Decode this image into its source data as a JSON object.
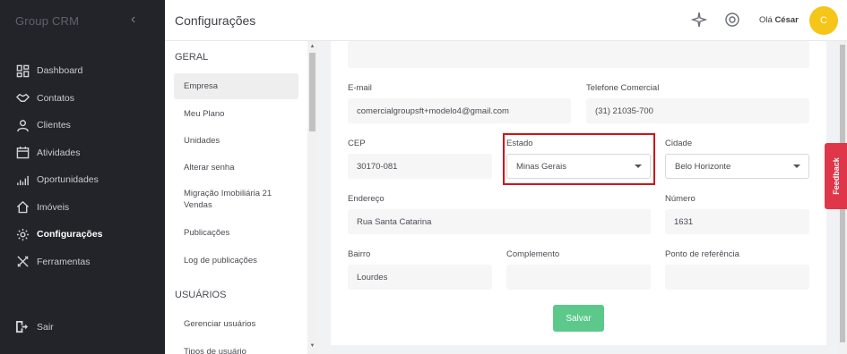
{
  "sidebar": {
    "brand": "Group CRM",
    "items": [
      {
        "label": "Dashboard",
        "icon": "dashboard-icon"
      },
      {
        "label": "Contatos",
        "icon": "handshake-icon"
      },
      {
        "label": "Clientes",
        "icon": "user-icon"
      },
      {
        "label": "Atividades",
        "icon": "calendar-icon"
      },
      {
        "label": "Oportunidades",
        "icon": "chart-icon"
      },
      {
        "label": "Imóveis",
        "icon": "home-icon"
      },
      {
        "label": "Configurações",
        "icon": "gear-icon",
        "active": true
      },
      {
        "label": "Ferramentas",
        "icon": "tools-icon"
      }
    ],
    "logout": "Sair"
  },
  "header": {
    "title": "Configurações",
    "greeting": "Olá",
    "user_name": "César",
    "avatar_letter": "C"
  },
  "submenu": {
    "section1": "GERAL",
    "items": [
      "Empresa",
      "Meu Plano",
      "Unidades",
      "Alterar senha",
      "Migração Imobiliária 21 Vendas",
      "Publicações",
      "Log de publicações"
    ],
    "section2": "USUÁRIOS",
    "items2": [
      "Gerenciar usuários",
      "Tipos de usuário"
    ]
  },
  "form": {
    "email_label": "E-mail",
    "email_value": "comercialgroupsft+modelo4@gmail.com",
    "phone_label": "Telefone Comercial",
    "phone_value": "(31) 21035-700",
    "cep_label": "CEP",
    "cep_value": "30170-081",
    "estado_label": "Estado",
    "estado_value": "Minas Gerais",
    "cidade_label": "Cidade",
    "cidade_value": "Belo Horizonte",
    "endereco_label": "Endereço",
    "endereco_value": "Rua Santa Catarina",
    "numero_label": "Número",
    "numero_value": "1631",
    "bairro_label": "Bairro",
    "bairro_value": "Lourdes",
    "complemento_label": "Complemento",
    "complemento_value": "",
    "referencia_label": "Ponto de referência",
    "referencia_value": "",
    "save_label": "Salvar"
  },
  "feedback_label": "Feedback",
  "colors": {
    "sidebar_bg": "#22242a",
    "accent_save": "#5cc98b",
    "highlight": "#d0141a",
    "avatar": "#f5c518",
    "feedback": "#e0364a"
  }
}
